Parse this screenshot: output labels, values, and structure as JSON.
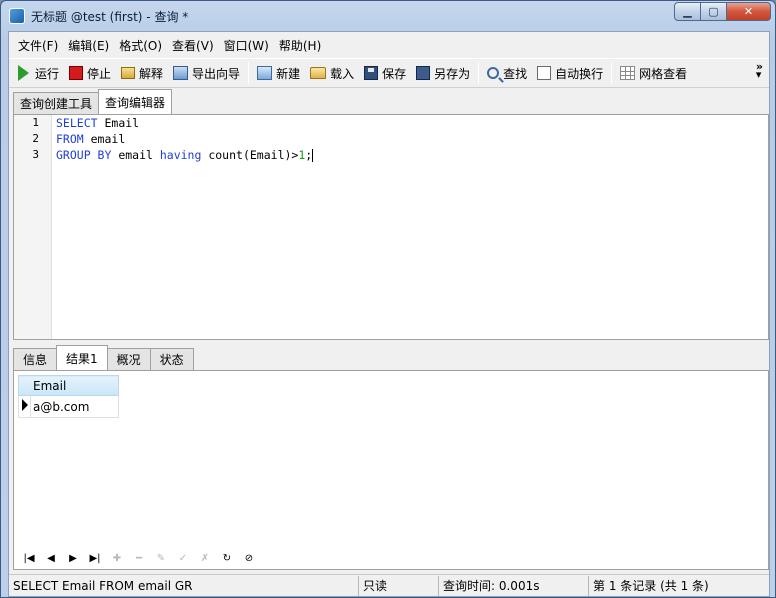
{
  "window": {
    "title": "无标题 @test (first) - 查询 *"
  },
  "menu": [
    "文件(F)",
    "编辑(E)",
    "格式(O)",
    "查看(V)",
    "窗口(W)",
    "帮助(H)"
  ],
  "toolbar": {
    "run": "运行",
    "stop": "停止",
    "explain": "解释",
    "export_wizard": "导出向导",
    "new": "新建",
    "load": "载入",
    "save": "保存",
    "save_as": "另存为",
    "find": "查找",
    "word_wrap": "自动换行",
    "grid_view": "网格查看"
  },
  "doc_tabs": [
    "查询创建工具",
    "查询编辑器"
  ],
  "editor": {
    "line_numbers": [
      "1",
      "2",
      "3"
    ],
    "lines": [
      [
        {
          "t": "SELECT",
          "k": "kw"
        },
        {
          "t": " Email",
          "k": ""
        }
      ],
      [
        {
          "t": "FROM",
          "k": "kw"
        },
        {
          "t": " email",
          "k": ""
        }
      ],
      [
        {
          "t": "GROUP BY",
          "k": "kw"
        },
        {
          "t": " email ",
          "k": ""
        },
        {
          "t": "having",
          "k": "kw"
        },
        {
          "t": " count(Email)>",
          "k": ""
        },
        {
          "t": "1",
          "k": "num"
        },
        {
          "t": ";",
          "k": ""
        }
      ]
    ]
  },
  "result_tabs": [
    "信息",
    "结果1",
    "概况",
    "状态"
  ],
  "result": {
    "columns": [
      "Email"
    ],
    "rows": [
      [
        "a@b.com"
      ]
    ]
  },
  "status": {
    "sql": "SELECT Email  FROM email  GR",
    "mode": "只读",
    "query_time": "查询时间: 0.001s",
    "records": "第 1 条记录 (共 1 条)"
  }
}
